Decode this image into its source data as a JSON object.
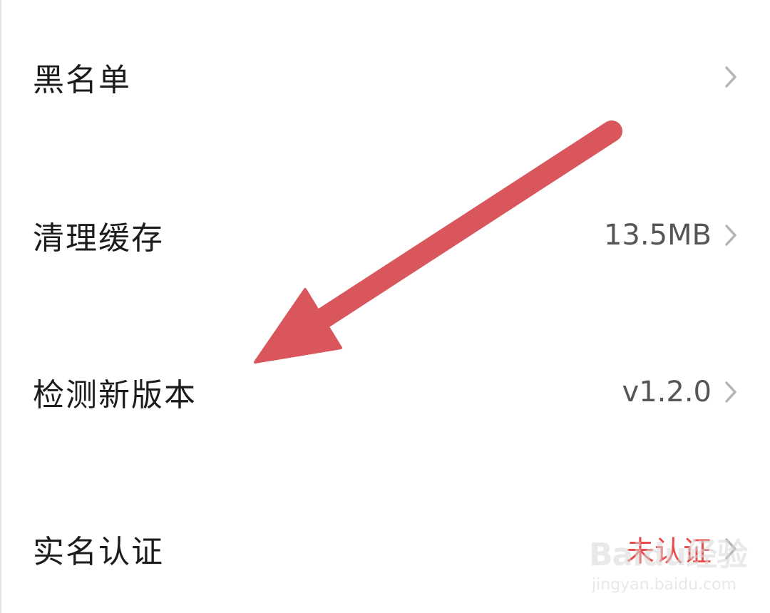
{
  "settings": {
    "items": [
      {
        "label": "黑名单",
        "value": ""
      },
      {
        "label": "清理缓存",
        "value": "13.5MB"
      },
      {
        "label": "检测新版本",
        "value": "v1.2.0"
      },
      {
        "label": "实名认证",
        "value": "未认证"
      }
    ]
  },
  "annotation": {
    "arrow_color": "#d9565c"
  },
  "watermark": {
    "logo_text": "Baidu经验",
    "url": "jingyan.baidu.com"
  },
  "colors": {
    "label": "#1c1c1c",
    "value": "#555555",
    "status_unverified": "#e74c4c",
    "chevron": "#b5b5b5"
  }
}
